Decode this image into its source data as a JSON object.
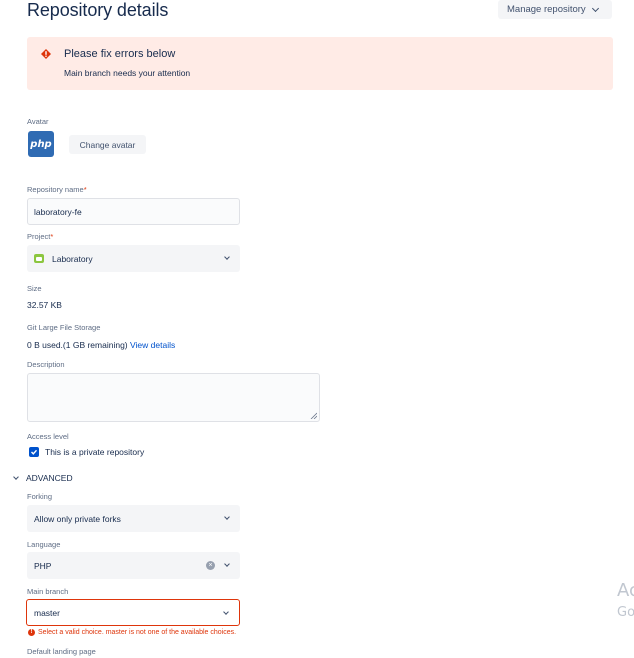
{
  "header": {
    "title": "Repository details",
    "manage_label": "Manage repository"
  },
  "error_banner": {
    "title": "Please fix errors below",
    "message": "Main branch needs your attention"
  },
  "avatar": {
    "label": "Avatar",
    "image_text": "php",
    "change_label": "Change avatar"
  },
  "repo_name": {
    "label": "Repository name",
    "required_mark": "*",
    "value": "laboratory-fe"
  },
  "project": {
    "label": "Project",
    "required_mark": "*",
    "value": "Laboratory",
    "icon": "folder-icon"
  },
  "size": {
    "label": "Size",
    "value": "32.57 KB"
  },
  "lfs": {
    "label": "Git Large File Storage",
    "usage": "0 B used.(1 GB remaining)",
    "link": "View details"
  },
  "description": {
    "label": "Description",
    "value": ""
  },
  "access": {
    "label": "Access level",
    "checkbox_label": "This is a private repository",
    "checked": true
  },
  "advanced": {
    "label": "ADVANCED"
  },
  "forking": {
    "label": "Forking",
    "value": "Allow only private forks"
  },
  "language": {
    "label": "Language",
    "value": "PHP"
  },
  "main_branch": {
    "label": "Main branch",
    "value": "master",
    "error": "Select a valid choice. master is not one of the available choices."
  },
  "landing_page": {
    "label": "Default landing page"
  },
  "watermark": {
    "line1": "Ac",
    "line2": "Go"
  },
  "colors": {
    "accent": "#0052cc",
    "error": "#de350b",
    "error_bg": "#ffebe6"
  }
}
